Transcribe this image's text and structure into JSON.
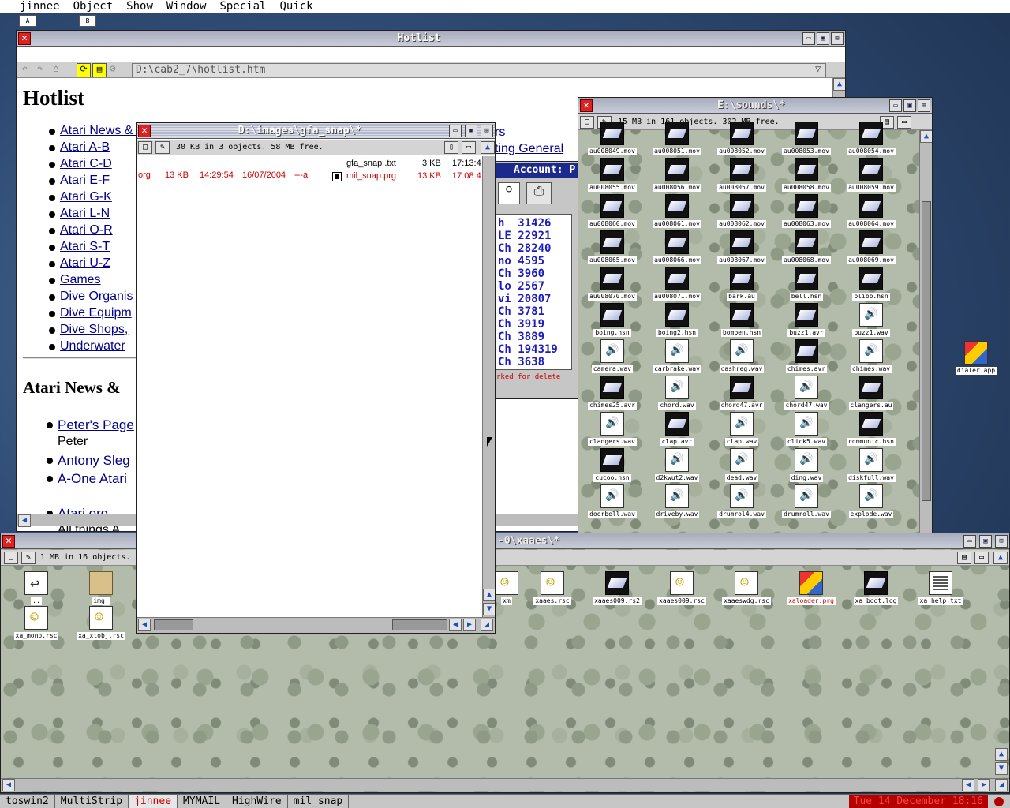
{
  "menubar": [
    "jinnee",
    "Object",
    "Show",
    "Window",
    "Special",
    "Quick"
  ],
  "desktop_tabs": [
    "A",
    "B"
  ],
  "desktop_icon": {
    "label": "dialer.app"
  },
  "hotlist": {
    "title": "Hotlist",
    "url": "D:\\cab2_7\\hotlist.htm",
    "heading": "Hotlist",
    "links": [
      "Atari News & Intro",
      "Atari A-B",
      "Atari C-D",
      "Atari E-F",
      "Atari G-K",
      "Atari L-N",
      "Atari O-R",
      "Atari S-T",
      "Atari U-Z",
      "Games",
      "Dive Organis",
      "Dive Equipm",
      "Dive Shops,",
      "Underwater"
    ],
    "right_links": [
      "rs",
      "ting General"
    ],
    "section2": "Atari News &",
    "news": [
      {
        "link": "Peter's Page",
        "sub": "Peter"
      },
      {
        "link": "Antony Sleg",
        "sub": ""
      },
      {
        "link": "A-One Atari",
        "sub": ""
      },
      {
        "link": "Atari.org",
        "sub": "All things A"
      }
    ]
  },
  "gfa": {
    "title": "D:\\images\\gfa_snap\\*",
    "info": "30 KB in 3 objects. 58 MB free.",
    "left_row": {
      "name": "org",
      "size": "13 KB",
      "time": "14:29:54",
      "date": "16/07/2004",
      "attr": "---a"
    },
    "right_rows": [
      {
        "name": "gfa_snap .txt",
        "size": "3 KB",
        "time": "17:13:4"
      },
      {
        "name": "mil_snap.prg",
        "size": "13 KB",
        "time": "17:08:4"
      }
    ]
  },
  "mail": {
    "header": "Account: P",
    "rows": [
      "h  31426",
      "LE 22921",
      "Ch 28240",
      "no 4595",
      "Ch 3960",
      "lo 2567",
      "vi 20807",
      "Ch 3781",
      "Ch 3919",
      "Ch 3889",
      "Ch 194319",
      "Ch 3638"
    ],
    "footer": "rked for delete"
  },
  "sounds": {
    "title": "E:\\sounds\\*",
    "info": "15 MB in 161 objects. 302 MB free.",
    "icons": [
      {
        "n": "au008049.mov",
        "t": "mov"
      },
      {
        "n": "au008051.mov",
        "t": "mov"
      },
      {
        "n": "au008052.mov",
        "t": "mov"
      },
      {
        "n": "au008053.mov",
        "t": "mov"
      },
      {
        "n": "au008054.mov",
        "t": "mov"
      },
      {
        "n": "au008055.mov",
        "t": "mov"
      },
      {
        "n": "au008056.mov",
        "t": "mov"
      },
      {
        "n": "au008057.mov",
        "t": "mov"
      },
      {
        "n": "au008058.mov",
        "t": "mov"
      },
      {
        "n": "au008059.mov",
        "t": "mov"
      },
      {
        "n": "au008060.mov",
        "t": "mov"
      },
      {
        "n": "au008061.mov",
        "t": "mov"
      },
      {
        "n": "au008062.mov",
        "t": "mov"
      },
      {
        "n": "au008063.mov",
        "t": "mov"
      },
      {
        "n": "au008064.mov",
        "t": "mov"
      },
      {
        "n": "au008065.mov",
        "t": "mov"
      },
      {
        "n": "au008066.mov",
        "t": "mov"
      },
      {
        "n": "au008067.mov",
        "t": "mov"
      },
      {
        "n": "au008068.mov",
        "t": "mov"
      },
      {
        "n": "au008069.mov",
        "t": "mov"
      },
      {
        "n": "au008070.mov",
        "t": "mov"
      },
      {
        "n": "au008071.mov",
        "t": "mov"
      },
      {
        "n": "bark.au",
        "t": "mov"
      },
      {
        "n": "bell.hsn",
        "t": "mov"
      },
      {
        "n": "blibb.hsn",
        "t": "mov"
      },
      {
        "n": "boing.hsn",
        "t": "mov"
      },
      {
        "n": "boing2.hsn",
        "t": "mov"
      },
      {
        "n": "bomben.hsn",
        "t": "mov"
      },
      {
        "n": "buzz1.avr",
        "t": "mov"
      },
      {
        "n": "buzz1.wav",
        "t": "wav"
      },
      {
        "n": "camera.wav",
        "t": "wav"
      },
      {
        "n": "carbrake.wav",
        "t": "wav"
      },
      {
        "n": "cashreg.wav",
        "t": "wav"
      },
      {
        "n": "chimes.avr",
        "t": "mov"
      },
      {
        "n": "chimes.wav",
        "t": "wav"
      },
      {
        "n": "chimes25.avr",
        "t": "mov"
      },
      {
        "n": "chord.wav",
        "t": "wav"
      },
      {
        "n": "chord47.avr",
        "t": "mov"
      },
      {
        "n": "chord47.wav",
        "t": "wav"
      },
      {
        "n": "clangers.au",
        "t": "mov"
      },
      {
        "n": "clangers.wav",
        "t": "wav"
      },
      {
        "n": "clap.avr",
        "t": "mov"
      },
      {
        "n": "clap.wav",
        "t": "wav"
      },
      {
        "n": "click5.wav",
        "t": "wav"
      },
      {
        "n": "communic.hsn",
        "t": "mov"
      },
      {
        "n": "cucoo.hsn",
        "t": "mov"
      },
      {
        "n": "d2kwut2.wav",
        "t": "wav"
      },
      {
        "n": "dead.wav",
        "t": "wav"
      },
      {
        "n": "ding.wav",
        "t": "wav"
      },
      {
        "n": "diskfull.wav",
        "t": "wav"
      },
      {
        "n": "doorbell.wav",
        "t": "wav"
      },
      {
        "n": "driveby.wav",
        "t": "wav"
      },
      {
        "n": "drumrol4.wav",
        "t": "wav"
      },
      {
        "n": "drumroll.wav",
        "t": "wav"
      },
      {
        "n": "explode.wav",
        "t": "wav"
      }
    ]
  },
  "xaaes": {
    "title": "-0\\xaaes\\*",
    "info": "1 MB in 16 objects.",
    "left_icons": [
      {
        "n": "..",
        "t": "back"
      },
      {
        "n": "img_",
        "t": "folder"
      },
      {
        "n": "xa_mono.rsc",
        "t": "rsc"
      },
      {
        "n": "xa_xtobj.rsc",
        "t": "rsc"
      }
    ],
    "right_icons": [
      {
        "n": "xm",
        "t": "rsc"
      },
      {
        "n": "xaaes.rsc",
        "t": "rsc"
      },
      {
        "n": "xaaes009.rs2",
        "t": "mov"
      },
      {
        "n": "xaaes009.rsc",
        "t": "rsc"
      },
      {
        "n": "xaaeswdg.rsc",
        "t": "rsc"
      },
      {
        "n": "xaloader.prg",
        "t": "prg"
      },
      {
        "n": "xa_boot.log",
        "t": "mov"
      },
      {
        "n": "xa_help.txt",
        "t": "doc"
      }
    ]
  },
  "taskbar": {
    "items": [
      "toswin2",
      "MultiStrip",
      "jinnee",
      "MYMAIL",
      "HighWire",
      "mil_snap"
    ],
    "active": "jinnee",
    "clock": "Tue 14 December 18:16"
  }
}
